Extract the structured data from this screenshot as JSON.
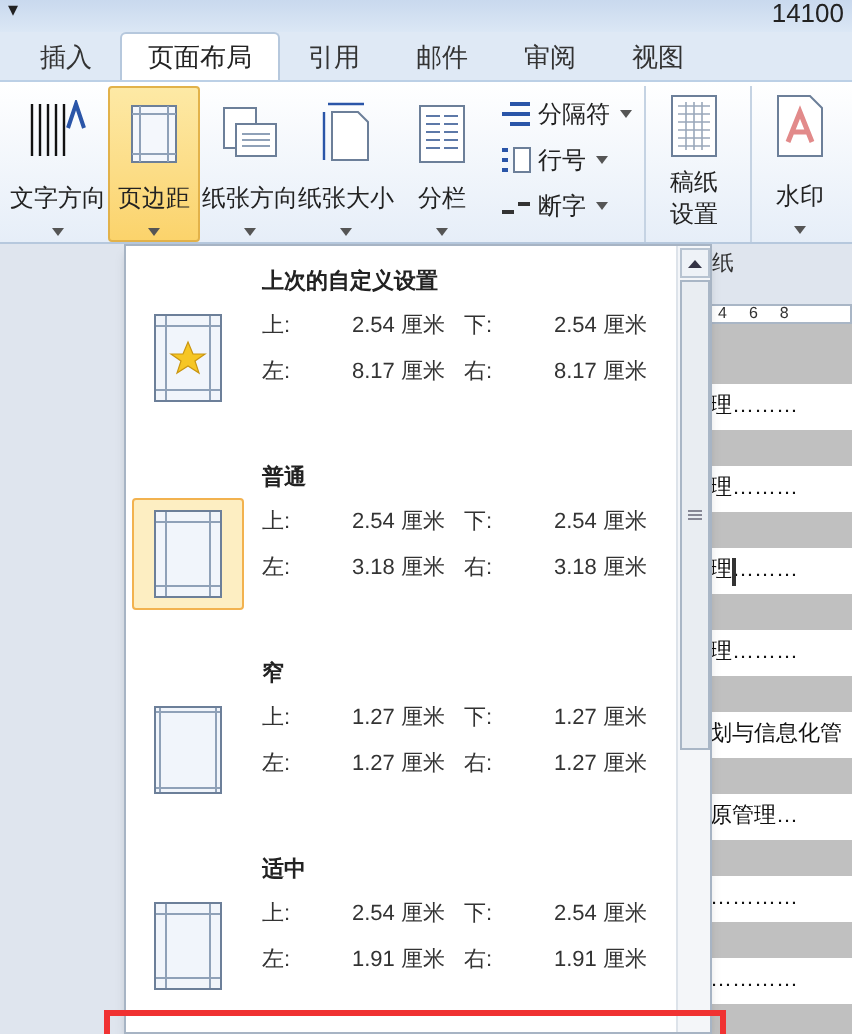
{
  "quick_access": {
    "glyph": "▾"
  },
  "window": {
    "title": "14100"
  },
  "tabs": [
    {
      "label": "插入",
      "selected": false
    },
    {
      "label": "页面布局",
      "selected": true
    },
    {
      "label": "引用",
      "selected": false
    },
    {
      "label": "邮件",
      "selected": false
    },
    {
      "label": "审阅",
      "selected": false
    },
    {
      "label": "视图",
      "selected": false
    }
  ],
  "ribbon": {
    "large_buttons": [
      {
        "kind": "text-direction",
        "label": "文字方向",
        "dropdown": true,
        "selected": false
      },
      {
        "kind": "margins",
        "label": "页边距",
        "dropdown": true,
        "selected": true
      },
      {
        "kind": "orientation",
        "label": "纸张方向",
        "dropdown": true,
        "selected": false
      },
      {
        "kind": "size",
        "label": "纸张大小",
        "dropdown": true,
        "selected": false
      },
      {
        "kind": "columns",
        "label": "分栏",
        "dropdown": true,
        "selected": false
      }
    ],
    "small_buttons": [
      {
        "kind": "breaks",
        "label": "分隔符",
        "dropdown": true
      },
      {
        "kind": "line-numbers",
        "label": "行号",
        "dropdown": true
      },
      {
        "kind": "hyphenation",
        "label": "断字",
        "dropdown": true
      }
    ],
    "manuscript_button": {
      "label_lines": [
        "稿纸",
        "设置"
      ]
    },
    "watermark_button": {
      "label": "水印",
      "dropdown": true
    },
    "group_label": "纸"
  },
  "margins_menu": {
    "items": [
      {
        "title": "上次的自定义设置",
        "kind": "custom",
        "selected": false,
        "rows": [
          [
            "上:",
            "2.54 厘米",
            "下:",
            "2.54 厘米"
          ],
          [
            "左:",
            "8.17 厘米",
            "右:",
            "8.17 厘米"
          ]
        ]
      },
      {
        "title": "普通",
        "kind": "normal",
        "selected": true,
        "rows": [
          [
            "上:",
            "2.54 厘米",
            "下:",
            "2.54 厘米"
          ],
          [
            "左:",
            "3.18 厘米",
            "右:",
            "3.18 厘米"
          ]
        ]
      },
      {
        "title": "窄",
        "kind": "narrow",
        "selected": false,
        "rows": [
          [
            "上:",
            "1.27 厘米",
            "下:",
            "1.27 厘米"
          ],
          [
            "左:",
            "1.27 厘米",
            "右:",
            "1.27 厘米"
          ]
        ]
      },
      {
        "title": "适中",
        "kind": "moderate",
        "selected": false,
        "rows": [
          [
            "上:",
            "2.54 厘米",
            "下:",
            "2.54 厘米"
          ],
          [
            "左:",
            "1.91 厘米",
            "右:",
            "1.91 厘米"
          ]
        ]
      }
    ]
  },
  "document": {
    "ruler": [
      "4",
      "6",
      "8"
    ],
    "lines": [
      {
        "text": "理………",
        "cursor": false
      },
      {
        "text": "理………",
        "cursor": false
      },
      {
        "text": "理………",
        "cursor": true
      },
      {
        "text": "理………",
        "cursor": false
      },
      {
        "text": "划与信息化管",
        "cursor": false
      },
      {
        "text": "原管理…",
        "cursor": false
      },
      {
        "text": "…………",
        "cursor": false
      },
      {
        "text": "…………",
        "cursor": false
      }
    ]
  }
}
